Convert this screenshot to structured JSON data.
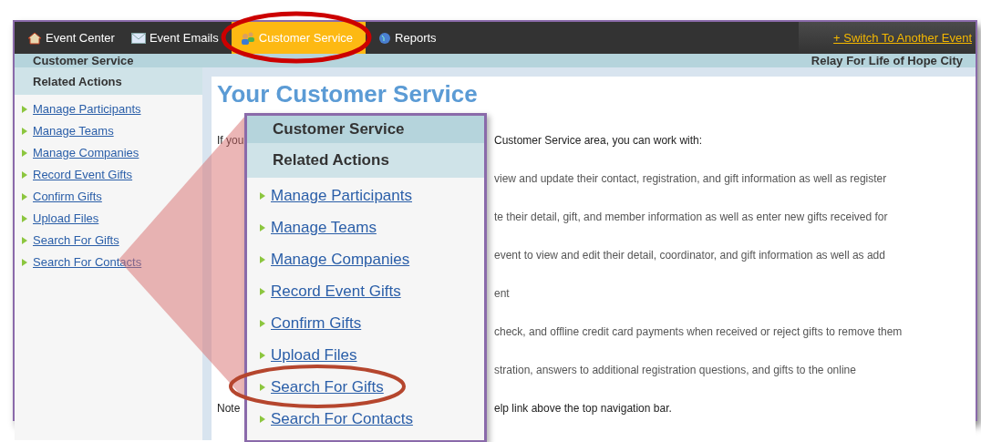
{
  "nav": {
    "tabs": [
      {
        "label": "Event Center",
        "selected": false,
        "circled": false
      },
      {
        "label": "Event Emails",
        "selected": false,
        "circled": false
      },
      {
        "label": "Customer Service",
        "selected": true,
        "circled": true
      },
      {
        "label": "Reports",
        "selected": false,
        "circled": false
      }
    ],
    "switch_link": "+ Switch To Another Event"
  },
  "subheader": {
    "title": "Customer Service",
    "event": "Relay For Life of Hope City"
  },
  "sidebar": {
    "heading": "Related Actions",
    "links": [
      "Manage Participants",
      "Manage Teams",
      "Manage Companies",
      "Record Event Gifts",
      "Confirm Gifts",
      "Upload Files",
      "Search For Gifts",
      "Search For Contacts"
    ]
  },
  "content": {
    "heading": "Your Customer Service",
    "lines": [
      {
        "left": "If you",
        "right": "Customer Service area, you can work with:",
        "dark": true
      },
      {
        "right": "view and update their contact, registration, and gift information as well as register",
        "dark": false
      },
      {
        "right": "te their detail, gift, and member information as well as enter new gifts received for",
        "dark": false
      },
      {
        "right": "event to view and edit their detail, coordinator, and gift information as well as add",
        "dark": false
      },
      {
        "right": "ent",
        "dark": false
      },
      {
        "right": "check, and offline credit card payments when received or reject gifts to remove them",
        "dark": false
      },
      {
        "right": "stration, answers to additional registration questions, and gifts to the online",
        "dark": false
      },
      {
        "left": "Note",
        "right": "elp link above the top navigation bar.",
        "dark": true
      }
    ]
  },
  "callout": {
    "title": "Customer Service",
    "heading": "Related Actions",
    "links": [
      {
        "label": "Manage Participants",
        "circled": false
      },
      {
        "label": "Manage Teams",
        "circled": false
      },
      {
        "label": "Manage Companies",
        "circled": false
      },
      {
        "label": "Record Event Gifts",
        "circled": false
      },
      {
        "label": "Confirm Gifts",
        "circled": false
      },
      {
        "label": "Upload Files",
        "circled": false
      },
      {
        "label": "Search For Gifts",
        "circled": true
      },
      {
        "label": "Search For Contacts",
        "circled": false
      }
    ]
  }
}
